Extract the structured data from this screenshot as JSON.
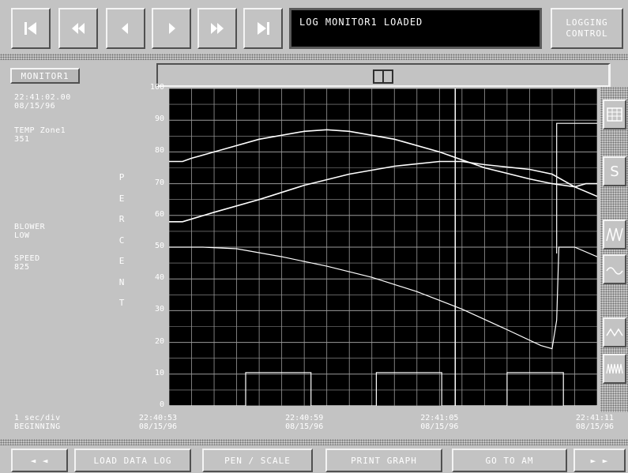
{
  "toolbar": {
    "buttons": [
      {
        "name": "first-record-button",
        "icon": "skip-to-start-icon"
      },
      {
        "name": "rewind-button",
        "icon": "fast-rewind-icon"
      },
      {
        "name": "step-back-button",
        "icon": "step-back-icon"
      },
      {
        "name": "step-forward-button",
        "icon": "step-forward-icon"
      },
      {
        "name": "fast-forward-button",
        "icon": "fast-forward-icon"
      },
      {
        "name": "last-record-button",
        "icon": "skip-to-end-icon"
      }
    ],
    "message": "LOG MONITOR1 LOADED",
    "logging_control": {
      "line1": "LOGGING",
      "line2": "CONTROL"
    }
  },
  "monitor": {
    "name": "MONITOR1",
    "cursor_time": "22:41:02.00",
    "cursor_date": "08/15/96",
    "tag1_label": "TEMP Zone1",
    "tag1_value": "351",
    "tag2_label": "BLOWER",
    "tag2_value": "LOW",
    "tag3_label": "SPEED",
    "tag3_value": "825"
  },
  "axis": {
    "ylabel": "PERCENT",
    "yticks": [
      "100",
      "90",
      "80",
      "70",
      "60",
      "50",
      "40",
      "30",
      "20",
      "10",
      "0"
    ],
    "xticks": [
      {
        "time": "22:40:53",
        "date": "08/15/96"
      },
      {
        "time": "22:40:59",
        "date": "08/15/96"
      },
      {
        "time": "22:41:05",
        "date": "08/15/96"
      },
      {
        "time": "22:41:11",
        "date": "08/15/96"
      }
    ]
  },
  "status": {
    "resolution": "1 sec/div",
    "position": "BEGINNING"
  },
  "side_tools": [
    "table-icon",
    "s-icon",
    "wave-sharp-icon",
    "wave-smooth-icon",
    "wave-triangle-icon",
    "wave-dense-icon"
  ],
  "side_tool_s_label": "S",
  "bottom_buttons": {
    "prev": "◄ ◄",
    "load": "LOAD DATA LOG",
    "pen": "PEN / SCALE",
    "print": "PRINT GRAPH",
    "goto": "GO TO AM",
    "next": "► ►"
  },
  "colors": {
    "plot_bg": "#000000",
    "grid": "#9a9a9a",
    "trace": "#ffffff",
    "panel": "#c3c3c3"
  },
  "chart_data": {
    "type": "line",
    "ylim": [
      0,
      100
    ],
    "xlim_seconds": [
      0,
      19
    ],
    "grid": true,
    "cursor_x": 12.7,
    "series": [
      {
        "values": [
          [
            0,
            77
          ],
          [
            0.6,
            77
          ],
          [
            1,
            78
          ],
          [
            2.5,
            81
          ],
          [
            4,
            84
          ],
          [
            6,
            86.5
          ],
          [
            7,
            87
          ],
          [
            8,
            86.5
          ],
          [
            10,
            84
          ],
          [
            12,
            80
          ],
          [
            14,
            75
          ],
          [
            16,
            71.5
          ],
          [
            17,
            70
          ],
          [
            18,
            69
          ],
          [
            19,
            66
          ]
        ]
      },
      {
        "values": [
          [
            0,
            58
          ],
          [
            0.6,
            58
          ],
          [
            2,
            61
          ],
          [
            4,
            65
          ],
          [
            6,
            69.5
          ],
          [
            8,
            73
          ],
          [
            10,
            75.5
          ],
          [
            12,
            77
          ],
          [
            13,
            77
          ],
          [
            14,
            76
          ],
          [
            16,
            74.5
          ],
          [
            17,
            73
          ],
          [
            17.5,
            71
          ],
          [
            18,
            69
          ],
          [
            18.5,
            70
          ],
          [
            19,
            70
          ]
        ]
      },
      {
        "values": [
          [
            0,
            50
          ],
          [
            1.5,
            50
          ],
          [
            3,
            49.5
          ],
          [
            5,
            47
          ],
          [
            7,
            44
          ],
          [
            9,
            40.5
          ],
          [
            11,
            36
          ],
          [
            13,
            30.5
          ],
          [
            15,
            24
          ],
          [
            16.5,
            19
          ],
          [
            17,
            18
          ],
          [
            17.2,
            27
          ],
          [
            17.3,
            50
          ],
          [
            18,
            50
          ],
          [
            19,
            47
          ]
        ]
      },
      {
        "values": [
          [
            0,
            0
          ],
          [
            3.4,
            0
          ],
          [
            3.4,
            10.5
          ],
          [
            6.3,
            10.5
          ],
          [
            6.3,
            0
          ],
          [
            9.2,
            0
          ],
          [
            9.2,
            10.5
          ],
          [
            12.1,
            10.5
          ],
          [
            12.1,
            0
          ],
          [
            15,
            0
          ],
          [
            15,
            10.5
          ],
          [
            17.5,
            10.5
          ],
          [
            17.5,
            0
          ],
          [
            19,
            0
          ]
        ]
      },
      {
        "values": [
          [
            17.2,
            48
          ],
          [
            17.2,
            89
          ],
          [
            19,
            89
          ]
        ]
      }
    ]
  }
}
